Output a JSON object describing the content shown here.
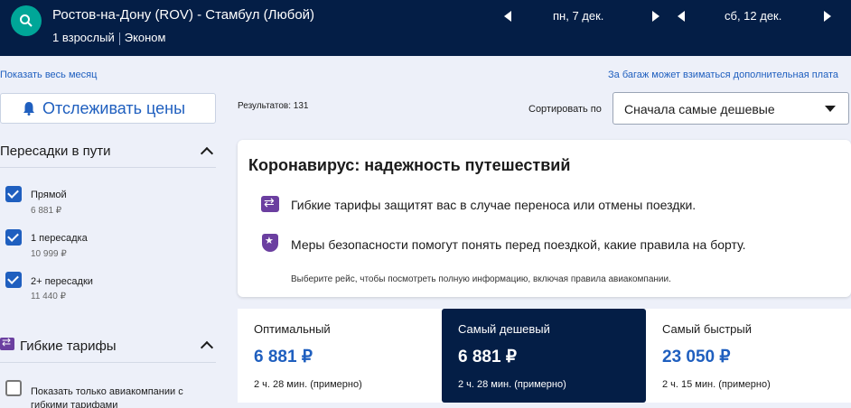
{
  "header": {
    "route": "Ростов-на-Дону (ROV) - Стамбул (Любой)",
    "passengers": "1 взрослый",
    "cabin": "Эконом",
    "depart_date": "пн, 7 дек.",
    "return_date": "сб, 12 дек."
  },
  "links": {
    "show_month": "Показать весь месяц",
    "baggage_note": "За багаж может взиматься дополнительная плата"
  },
  "sidebar": {
    "track_prices": "Отслеживать цены",
    "stops_title": "Пересадки в пути",
    "stops": [
      {
        "label": "Прямой",
        "price": "6 881 ₽",
        "checked": true
      },
      {
        "label": "1 пересадка",
        "price": "10 999 ₽",
        "checked": true
      },
      {
        "label": "2+ пересадки",
        "price": "11 440 ₽",
        "checked": true
      }
    ],
    "flex_title": "Гибкие тарифы",
    "flex_option": "Показать только авиакомпании с гибкими тарифами"
  },
  "main": {
    "results_count": "Результатов: 131",
    "sort_label": "Сортировать по",
    "sort_value": "Сначала самые дешевые"
  },
  "covid": {
    "title": "Коронавирус: надежность путешествий",
    "line1": "Гибкие тарифы защитят вас в случае переноса или отмены поездки.",
    "line2": "Меры безопасности помогут понять перед поездкой, какие правила на борту.",
    "note": "Выберите рейс, чтобы посмотреть полную информацию, включая правила авиакомпании."
  },
  "tabs": [
    {
      "name": "Оптимальный",
      "price": "6 881 ₽",
      "duration": "2 ч. 28 мин. (примерно)"
    },
    {
      "name": "Самый дешевый",
      "price": "6 881 ₽",
      "duration": "2 ч. 28 мин. (примерно)"
    },
    {
      "name": "Самый быстрый",
      "price": "23 050 ₽",
      "duration": "2 ч. 15 мин. (примерно)"
    }
  ],
  "colors": {
    "header_bg": "#041e46",
    "accent_blue": "#1f5fbf",
    "search_teal": "#00a698",
    "flex_purple": "#6b3fa0"
  }
}
